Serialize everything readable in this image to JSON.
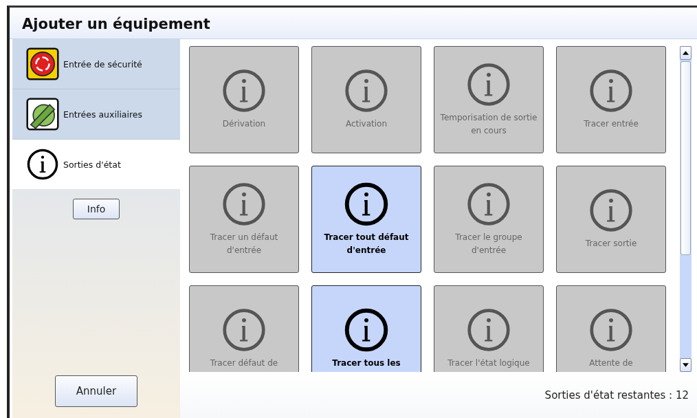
{
  "window": {
    "title": "Ajouter un équipement"
  },
  "sidebar": {
    "items": [
      {
        "label": "Entrée de sécurité",
        "kind": "stop",
        "selected": false
      },
      {
        "label": "Entrées auxiliaires",
        "kind": "switch",
        "selected": false
      },
      {
        "label": "Sorties d'état",
        "kind": "info",
        "selected": true
      }
    ],
    "info_button": "Info",
    "cancel_button": "Annuler"
  },
  "tiles": [
    {
      "label": "Dérivation",
      "selected": false
    },
    {
      "label": "Activation",
      "selected": false
    },
    {
      "label": "Temporisation de sortie en cours",
      "selected": false
    },
    {
      "label": "Tracer entrée",
      "selected": false
    },
    {
      "label": "Tracer un défaut d'entrée",
      "selected": false
    },
    {
      "label": "Tracer tout défaut d'entrée",
      "selected": true
    },
    {
      "label": "Tracer le groupe d'entrée",
      "selected": false
    },
    {
      "label": "Tracer sortie",
      "selected": false
    },
    {
      "label": "Tracer défaut de",
      "selected": false
    },
    {
      "label": "Tracer tous les",
      "selected": true
    },
    {
      "label": "Tracer l'état logique",
      "selected": false
    },
    {
      "label": "Attente de",
      "selected": false
    }
  ],
  "status": "Sorties d'état restantes : 12"
}
